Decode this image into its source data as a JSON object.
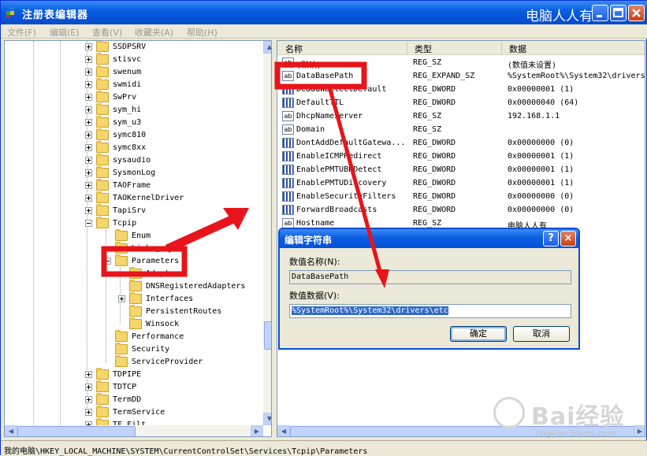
{
  "window": {
    "title": "注册表编辑器",
    "watermark": "电脑人人有"
  },
  "menu": [
    "文件(F)",
    "编辑(E)",
    "查看(V)",
    "收藏夹(A)",
    "帮助(H)"
  ],
  "tree": {
    "items": [
      {
        "label": "SSDPSRV",
        "expander": "plus",
        "level": 0
      },
      {
        "label": "stisvc",
        "expander": "plus",
        "level": 0
      },
      {
        "label": "swenum",
        "expander": "plus",
        "level": 0
      },
      {
        "label": "swmidi",
        "expander": "plus",
        "level": 0
      },
      {
        "label": "SwPrv",
        "expander": "plus",
        "level": 0
      },
      {
        "label": "sym_hi",
        "expander": "plus",
        "level": 0
      },
      {
        "label": "sym_u3",
        "expander": "plus",
        "level": 0
      },
      {
        "label": "symc810",
        "expander": "plus",
        "level": 0
      },
      {
        "label": "symc8xx",
        "expander": "plus",
        "level": 0
      },
      {
        "label": "sysaudio",
        "expander": "plus",
        "level": 0
      },
      {
        "label": "SysmonLog",
        "expander": "plus",
        "level": 0
      },
      {
        "label": "TAOFrame",
        "expander": "plus",
        "level": 0
      },
      {
        "label": "TAOKernelDriver",
        "expander": "plus",
        "level": 0
      },
      {
        "label": "TapiSrv",
        "expander": "plus",
        "level": 0
      },
      {
        "label": "Tcpip",
        "expander": "minus",
        "level": 0
      },
      {
        "label": "Enum",
        "expander": "none",
        "level": 1
      },
      {
        "label": "Linkage",
        "expander": "none",
        "level": 1
      },
      {
        "label": "Parameters",
        "expander": "minus",
        "level": 1
      },
      {
        "label": "Adapters",
        "expander": "none",
        "level": 2
      },
      {
        "label": "DNSRegisteredAdapters",
        "expander": "none",
        "level": 2
      },
      {
        "label": "Interfaces",
        "expander": "plus",
        "level": 2
      },
      {
        "label": "PersistentRoutes",
        "expander": "none",
        "level": 2
      },
      {
        "label": "Winsock",
        "expander": "none",
        "level": 2
      },
      {
        "label": "Performance",
        "expander": "none",
        "level": 1
      },
      {
        "label": "Security",
        "expander": "none",
        "level": 1
      },
      {
        "label": "ServiceProvider",
        "expander": "none",
        "level": 1
      },
      {
        "label": "TDPIPE",
        "expander": "plus",
        "level": 0
      },
      {
        "label": "TDTCP",
        "expander": "plus",
        "level": 0
      },
      {
        "label": "TermDD",
        "expander": "plus",
        "level": 0
      },
      {
        "label": "TermService",
        "expander": "plus",
        "level": 0
      },
      {
        "label": "TF_Filt",
        "expander": "plus",
        "level": 0
      }
    ]
  },
  "list": {
    "headers": [
      "名称",
      "类型",
      "数据"
    ],
    "rows": [
      {
        "name": "(默认)",
        "type": "REG_SZ",
        "data": "(数值未设置)",
        "icon": "string"
      },
      {
        "name": "DataBasePath",
        "type": "REG_EXPAND_SZ",
        "data": "%SystemRoot%\\System32\\drivers",
        "icon": "string"
      },
      {
        "name": "DeadGWDetectDefault",
        "type": "REG_DWORD",
        "data": "0x00000001 (1)",
        "icon": "binary"
      },
      {
        "name": "DefaultTTL",
        "type": "REG_DWORD",
        "data": "0x00000040 (64)",
        "icon": "binary"
      },
      {
        "name": "DhcpNameServer",
        "type": "REG_SZ",
        "data": "192.168.1.1",
        "icon": "string"
      },
      {
        "name": "Domain",
        "type": "REG_SZ",
        "data": "",
        "icon": "string"
      },
      {
        "name": "DontAddDefaultGatewa...",
        "type": "REG_DWORD",
        "data": "0x00000000 (0)",
        "icon": "binary"
      },
      {
        "name": "EnableICMPRedirect",
        "type": "REG_DWORD",
        "data": "0x00000001 (1)",
        "icon": "binary"
      },
      {
        "name": "EnablePMTUBHDetect",
        "type": "REG_DWORD",
        "data": "0x00000001 (1)",
        "icon": "binary"
      },
      {
        "name": "EnablePMTUDiscovery",
        "type": "REG_DWORD",
        "data": "0x00000001 (1)",
        "icon": "binary"
      },
      {
        "name": "EnableSecurityFilters",
        "type": "REG_DWORD",
        "data": "0x00000000 (0)",
        "icon": "binary"
      },
      {
        "name": "ForwardBroadcasts",
        "type": "REG_DWORD",
        "data": "0x00000000 (0)",
        "icon": "binary"
      },
      {
        "name": "Hostname",
        "type": "REG_SZ",
        "data": "电脑人人有",
        "icon": "string"
      }
    ]
  },
  "dialog": {
    "title": "编辑字符串",
    "help": "?",
    "close": "×",
    "name_label": "数值名称(N):",
    "name_value": "DataBasePath",
    "data_label": "数值数据(V):",
    "data_value": "%SystemRoot%\\System32\\drivers\\etc",
    "ok": "确定",
    "cancel": "取消"
  },
  "status": "我的电脑\\HKEY_LOCAL_MACHINE\\SYSTEM\\CurrentControlSet\\Services\\Tcpip\\Parameters",
  "baidu": {
    "logo": "Bai经验",
    "site": "jingyan.baidu.com"
  },
  "colors": {
    "annotation": "#e8141b",
    "title_bar": "#0a5fe0",
    "selection": "#316ac5"
  }
}
